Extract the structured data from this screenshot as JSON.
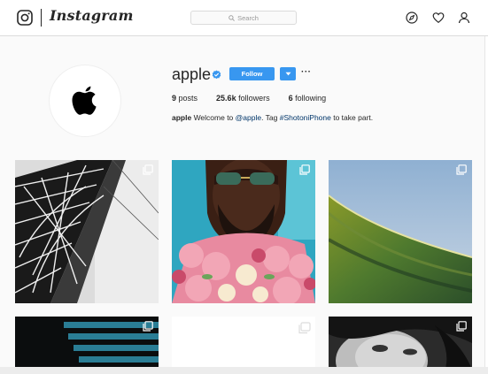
{
  "nav": {
    "logo_icon": "instagram-glyph-icon",
    "wordmark": "Instagram",
    "search_placeholder": "Search",
    "icons": [
      "compass-icon",
      "heart-icon",
      "user-icon"
    ]
  },
  "profile": {
    "username": "apple",
    "verified": true,
    "follow_label": "Follow",
    "more_label": "···",
    "stats": {
      "posts_count": "9",
      "posts_label": "posts",
      "followers_count": "25.6k",
      "followers_label": "followers",
      "following_count": "6",
      "following_label": "following"
    },
    "bio": {
      "name": "apple",
      "text_before": " Welcome to ",
      "mention": "@apple",
      "text_mid": ". Tag ",
      "hashtag": "#ShotoniPhone",
      "text_after": " to take part."
    }
  },
  "grid": {
    "posts": [
      {
        "subject": "eiffel-tower-lattice",
        "multi": true
      },
      {
        "subject": "man-with-sunglasses-and-roses",
        "multi": true
      },
      {
        "subject": "ocean-wave",
        "multi": true
      },
      {
        "subject": "dark-stripes",
        "multi": true
      },
      {
        "subject": "white-placeholder",
        "multi": true
      },
      {
        "subject": "black-and-white-portrait",
        "multi": true
      }
    ]
  },
  "colors": {
    "accent": "#3897f0",
    "link": "#003569",
    "text": "#262626",
    "border": "#dbdbdb",
    "background": "#fafafa"
  }
}
